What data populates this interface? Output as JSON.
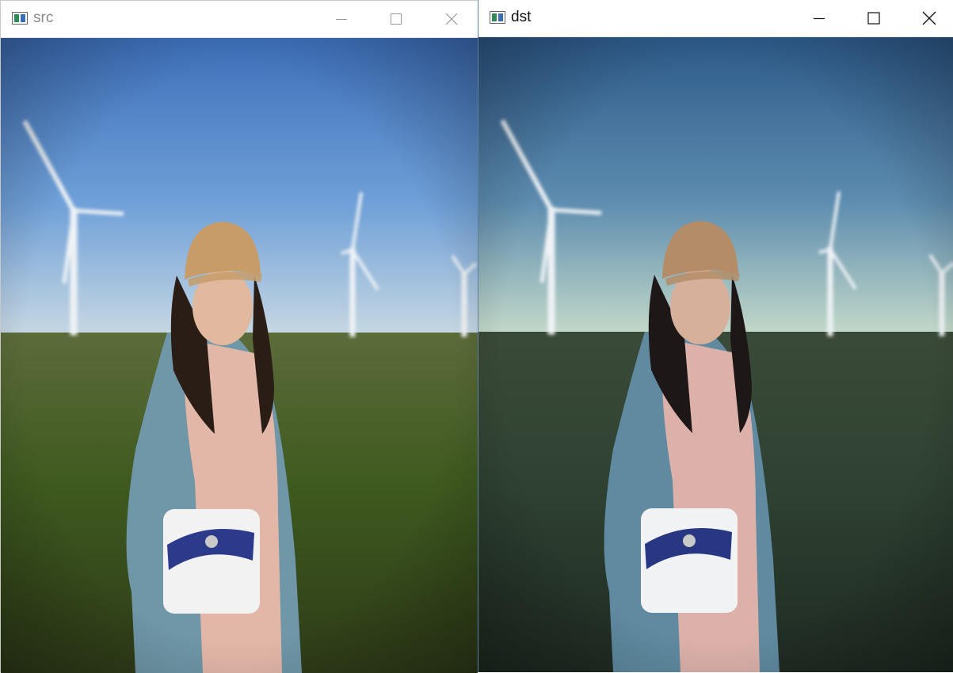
{
  "windows": [
    {
      "title": "src",
      "active": false,
      "image": {
        "description_icon": "photo",
        "palette": {
          "sky_top": "#3d6fb9",
          "sky_mid": "#6fa0d8",
          "sky_low": "#c9d9e3",
          "grass_far": "#5c6b3a",
          "grass_near": "#3f5a1f",
          "grass_dark": "#2e3b18",
          "cap": "#c79c68",
          "hair": "#2a1d16",
          "skin": "#e0b99f",
          "blouse": "#e2b7a8",
          "cardigan": "#6f97a8",
          "bag": "#f2f2f2",
          "bag_pattern": "#2c3a8c"
        }
      }
    },
    {
      "title": "dst",
      "active": true,
      "image": {
        "description_icon": "photo",
        "palette": {
          "sky_top": "#2d5a8a",
          "sky_mid": "#5e8db0",
          "sky_low": "#c6dbc9",
          "grass_far": "#3b4a38",
          "grass_near": "#2f4232",
          "grass_dark": "#1f2a22",
          "cap": "#b48d68",
          "hair": "#1e1717",
          "skin": "#d6b09b",
          "blouse": "#dcb1aa",
          "cardigan": "#5f8aa0",
          "bag": "#f0f2f4",
          "bag_pattern": "#273781"
        }
      }
    }
  ],
  "controls": {
    "minimize": "minimize-icon",
    "maximize": "maximize-icon",
    "close": "close-icon"
  }
}
